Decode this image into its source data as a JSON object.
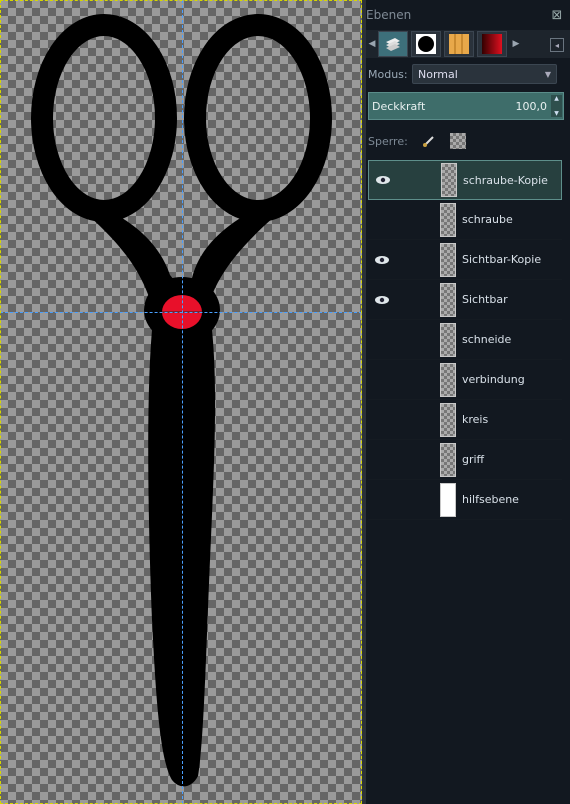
{
  "panel": {
    "title": "Ebenen",
    "close_glyph": "⊠",
    "tabs": [
      {
        "icon": "layers-icon",
        "active": true
      },
      {
        "icon": "brush-circle-icon",
        "active": false
      },
      {
        "icon": "pattern-icon",
        "active": false
      },
      {
        "icon": "gradient-icon",
        "active": false
      }
    ],
    "mode_label": "Modus:",
    "mode_value": "Normal",
    "opacity_label": "Deckkraft",
    "opacity_value": "100,0",
    "lock_label": "Sperre:",
    "layers": [
      {
        "name": "schraube-Kopie",
        "visible": true,
        "selected": true,
        "thumb": "checker"
      },
      {
        "name": "schraube",
        "visible": false,
        "selected": false,
        "thumb": "checker"
      },
      {
        "name": "Sichtbar-Kopie",
        "visible": true,
        "selected": false,
        "thumb": "checker"
      },
      {
        "name": "Sichtbar",
        "visible": true,
        "selected": false,
        "thumb": "checker"
      },
      {
        "name": "schneide",
        "visible": false,
        "selected": false,
        "thumb": "checker"
      },
      {
        "name": "verbindung",
        "visible": false,
        "selected": false,
        "thumb": "checker"
      },
      {
        "name": "kreis",
        "visible": false,
        "selected": false,
        "thumb": "checker"
      },
      {
        "name": "griff",
        "visible": false,
        "selected": false,
        "thumb": "checker"
      },
      {
        "name": "hilfsebene",
        "visible": false,
        "selected": false,
        "thumb": "white"
      }
    ]
  },
  "colors": {
    "selection": "#27403f",
    "opacity_bar": "#3e6d6a",
    "screw": "#e8102a",
    "guide": "#4aa0ff"
  }
}
